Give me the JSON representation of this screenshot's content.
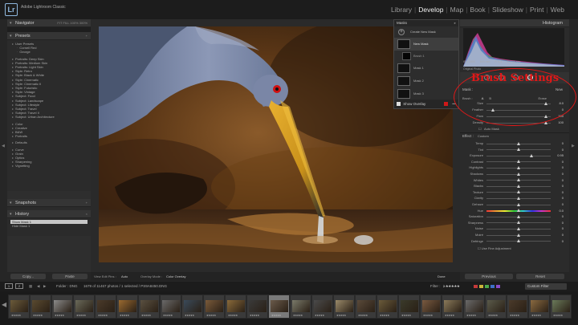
{
  "app": {
    "logo_text": "Lr",
    "catalog_title": "Adobe Lightroom Classic"
  },
  "modules": [
    {
      "label": "Library",
      "active": false
    },
    {
      "label": "Develop",
      "active": true
    },
    {
      "label": "Map",
      "active": false
    },
    {
      "label": "Book",
      "active": false
    },
    {
      "label": "Slideshow",
      "active": false
    },
    {
      "label": "Print",
      "active": false
    },
    {
      "label": "Web",
      "active": false
    }
  ],
  "left_panel": {
    "navigator": {
      "title": "Navigator",
      "zoom_options": "FIT  FILL  100%  300%"
    },
    "presets": {
      "title": "Presets",
      "items": [
        {
          "label": "User Presets",
          "sub": false,
          "gap": false
        },
        {
          "label": "Cornell Red",
          "sub": true,
          "gap": false
        },
        {
          "label": "George",
          "sub": true,
          "gap": false
        },
        {
          "label": "Portraits: Deep Skin",
          "sub": false,
          "gap": true
        },
        {
          "label": "Portraits: Medium Skin",
          "sub": false,
          "gap": false
        },
        {
          "label": "Portraits: Light Skin",
          "sub": false,
          "gap": false
        },
        {
          "label": "Style: Retro",
          "sub": false,
          "gap": false
        },
        {
          "label": "Style: Black & White",
          "sub": false,
          "gap": false
        },
        {
          "label": "Style: Cinematic",
          "sub": false,
          "gap": false
        },
        {
          "label": "Style: Cinematic II",
          "sub": false,
          "gap": false
        },
        {
          "label": "Style: Futuristic",
          "sub": false,
          "gap": false
        },
        {
          "label": "Style: Vintage",
          "sub": false,
          "gap": false
        },
        {
          "label": "Subject: Food",
          "sub": false,
          "gap": false
        },
        {
          "label": "Subject: Landscape",
          "sub": false,
          "gap": false
        },
        {
          "label": "Subject: Lifestyle",
          "sub": false,
          "gap": false
        },
        {
          "label": "Subject: Travel",
          "sub": false,
          "gap": false
        },
        {
          "label": "Subject: Travel II",
          "sub": false,
          "gap": false
        },
        {
          "label": "Subject: Urban Architecture",
          "sub": false,
          "gap": false
        },
        {
          "label": "Color",
          "sub": false,
          "gap": true
        },
        {
          "label": "Creative",
          "sub": false,
          "gap": false
        },
        {
          "label": "B&W",
          "sub": false,
          "gap": false
        },
        {
          "label": "Portraits",
          "sub": false,
          "gap": false
        },
        {
          "label": "Defaults",
          "sub": false,
          "gap": true
        },
        {
          "label": "Curve",
          "sub": false,
          "gap": true
        },
        {
          "label": "Grain",
          "sub": false,
          "gap": false
        },
        {
          "label": "Optics",
          "sub": false,
          "gap": false
        },
        {
          "label": "Sharpening",
          "sub": false,
          "gap": false
        },
        {
          "label": "Vignetting",
          "sub": false,
          "gap": false
        }
      ]
    },
    "snapshots": {
      "title": "Snapshots"
    },
    "history": {
      "title": "History",
      "items": [
        {
          "label": "Show Mask 1",
          "selected": true
        },
        {
          "label": "Hide Mask 1",
          "selected": false
        }
      ]
    },
    "copy_label": "Copy...",
    "paste_label": "Paste"
  },
  "masks_panel": {
    "title": "Masks",
    "create_label": "Create New Mask",
    "mask_rows": [
      {
        "label": "New Mask",
        "active": true
      },
      {
        "label": "Mask 1",
        "active": false
      },
      {
        "label": "Mask 2",
        "active": false
      },
      {
        "label": "Mask 3",
        "active": false
      }
    ],
    "sub_row_label": "Brush 1",
    "show_overlay_label": "Show Overlay",
    "overlay_color": "#d01818"
  },
  "right_panel": {
    "histogram_title": "Histogram",
    "histogram_info": [
      "ISO 1000",
      "600 mm",
      "f / 6.3",
      "1/1000 sec"
    ],
    "original_photo_label": "Original Photo",
    "mask_label": "Mask :",
    "mask_new_label": "New",
    "brush_label": "Brush :",
    "brush_a": "A",
    "brush_b": "B",
    "erase_label": "Erase",
    "annotation": "Brush Settings",
    "brush_sliders": [
      {
        "label": "Size",
        "pos": 0.93,
        "value": "8.0"
      },
      {
        "label": "Feather",
        "pos": 0.1,
        "value": "0"
      },
      {
        "label": "Flow",
        "pos": 0.93,
        "value": "100"
      },
      {
        "label": "Density",
        "pos": 0.93,
        "value": "100"
      }
    ],
    "auto_mask_label": "Auto Mask",
    "effect_label": "Effect :",
    "effect_value": "Custom",
    "effect_sliders": [
      {
        "label": "Temp",
        "pos": 0.5,
        "value": "0",
        "rainbow": false
      },
      {
        "label": "Tint",
        "pos": 0.5,
        "value": "0",
        "rainbow": false
      },
      {
        "label": "Exposure",
        "pos": 0.7,
        "value": "0.95",
        "rainbow": false
      },
      {
        "label": "Contrast",
        "pos": 0.5,
        "value": "0",
        "rainbow": false
      },
      {
        "label": "Highlights",
        "pos": 0.5,
        "value": "0",
        "rainbow": false
      },
      {
        "label": "Shadows",
        "pos": 0.5,
        "value": "0",
        "rainbow": false
      },
      {
        "label": "Whites",
        "pos": 0.5,
        "value": "0",
        "rainbow": false
      },
      {
        "label": "Blacks",
        "pos": 0.5,
        "value": "0",
        "rainbow": false
      },
      {
        "label": "Texture",
        "pos": 0.5,
        "value": "0",
        "rainbow": false
      },
      {
        "label": "Clarity",
        "pos": 0.5,
        "value": "0",
        "rainbow": false
      },
      {
        "label": "Dehaze",
        "pos": 0.5,
        "value": "0",
        "rainbow": false
      },
      {
        "label": "Hue",
        "pos": 0.5,
        "value": "0.0",
        "rainbow": true
      },
      {
        "label": "Saturation",
        "pos": 0.5,
        "value": "0",
        "rainbow": false
      },
      {
        "label": "Sharpness",
        "pos": 0.5,
        "value": "0",
        "rainbow": false
      },
      {
        "label": "Noise",
        "pos": 0.5,
        "value": "0",
        "rainbow": false
      },
      {
        "label": "Moiré",
        "pos": 0.5,
        "value": "0",
        "rainbow": false
      },
      {
        "label": "Defringe",
        "pos": 0.5,
        "value": "0",
        "rainbow": false
      }
    ],
    "use_fine_label": "Use Fine Adjustment",
    "previous_label": "Previous",
    "reset_label": "Reset"
  },
  "toolbar": {
    "view_edit_pins_label": "View Edit Pins :",
    "view_edit_pins_value": "Auto",
    "overlay_mode_label": "Overlay Mode :",
    "overlay_mode_value": "Color Overlay",
    "done_label": "Done"
  },
  "filmstrip_bar": {
    "page_1": "1",
    "page_2": "2",
    "folder_text": "Folder : DNG",
    "count_text": "1679 of 11467 photos / 1 selected / PS9A8450.DNG",
    "filter_label": "Filter :",
    "custom_filter_label": "Custom Filter",
    "flag_colors": [
      "#c43a3a",
      "#c9b43a",
      "#4aa84a",
      "#3f6fc8",
      "#8a4ac8"
    ]
  },
  "filmstrip": {
    "stars": "★★★★★",
    "thumb_colors": [
      "#6b5a3a",
      "#5a4a30",
      "#8a8a8a",
      "#6a6a5a",
      "#4a3a2a",
      "#9a6a30",
      "#5a5040",
      "#6a6a6a",
      "#3a4a5a",
      "#7a5a3a",
      "#8a6a3a",
      "#3a3a3a",
      "#6a5a4a",
      "#7a7a6a",
      "#4a4a4a",
      "#9a8a6a",
      "#5a4a3a",
      "#6a5a3a",
      "#3a3a2a",
      "#7a5a40",
      "#8a7a5a",
      "#6a6a6a",
      "#5a5a4a",
      "#4a3a2a",
      "#8a6a40",
      "#6a7a5a"
    ],
    "selected_index": 12
  },
  "photo": {
    "description_colors": {
      "bg_dark": "#2a1a0e",
      "bg_warm": "#7a4a1e",
      "heron_body": "#6f7d98",
      "heron_neck": "#8a95b0",
      "beak": "#d9a020",
      "eye": "#d01010"
    }
  }
}
